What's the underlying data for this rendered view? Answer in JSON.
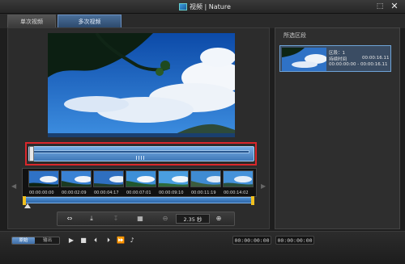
{
  "window": {
    "title": "视频 | Nature",
    "maximize_icon": "maximize-icon",
    "close_icon": "close-icon",
    "maximize_glyph": "⬚",
    "close_glyph": "✕"
  },
  "tabs": [
    {
      "label": "单次视频"
    },
    {
      "label": "多次视频"
    }
  ],
  "selected_panel": {
    "title": "所选区段",
    "clip": {
      "name": "区段：1",
      "duration_label": "持续时间",
      "duration": "00:00:16.11",
      "range": "00:00:00:00 - 00:00:16.11"
    }
  },
  "filmstrip": {
    "times": [
      "00:00:00:00",
      "00:00:02:09",
      "00:00:04:17",
      "00:00:07:01",
      "00:00:09:10",
      "00:00:11:19",
      "00:00:14:02"
    ]
  },
  "toolbar": {
    "zoom_value": "2.35 秒",
    "icons": [
      "move-icon",
      "trim-icon",
      "cut-icon",
      "multi-trim-icon",
      "zoom-out-icon",
      "zoom-in-icon"
    ]
  },
  "playback": {
    "mode_original": "原始",
    "mode_output": "输出",
    "controls": [
      "play-icon",
      "stop-icon",
      "prev-frame-icon",
      "next-frame-icon",
      "fast-forward-icon",
      "volume-icon"
    ],
    "timecode_in": "00:00:00:00",
    "timecode_out": "00:00:00:00"
  },
  "colors": {
    "accent": "#3f78b8",
    "trim_highlight": "#d9272b",
    "marker": "#f0c020"
  }
}
